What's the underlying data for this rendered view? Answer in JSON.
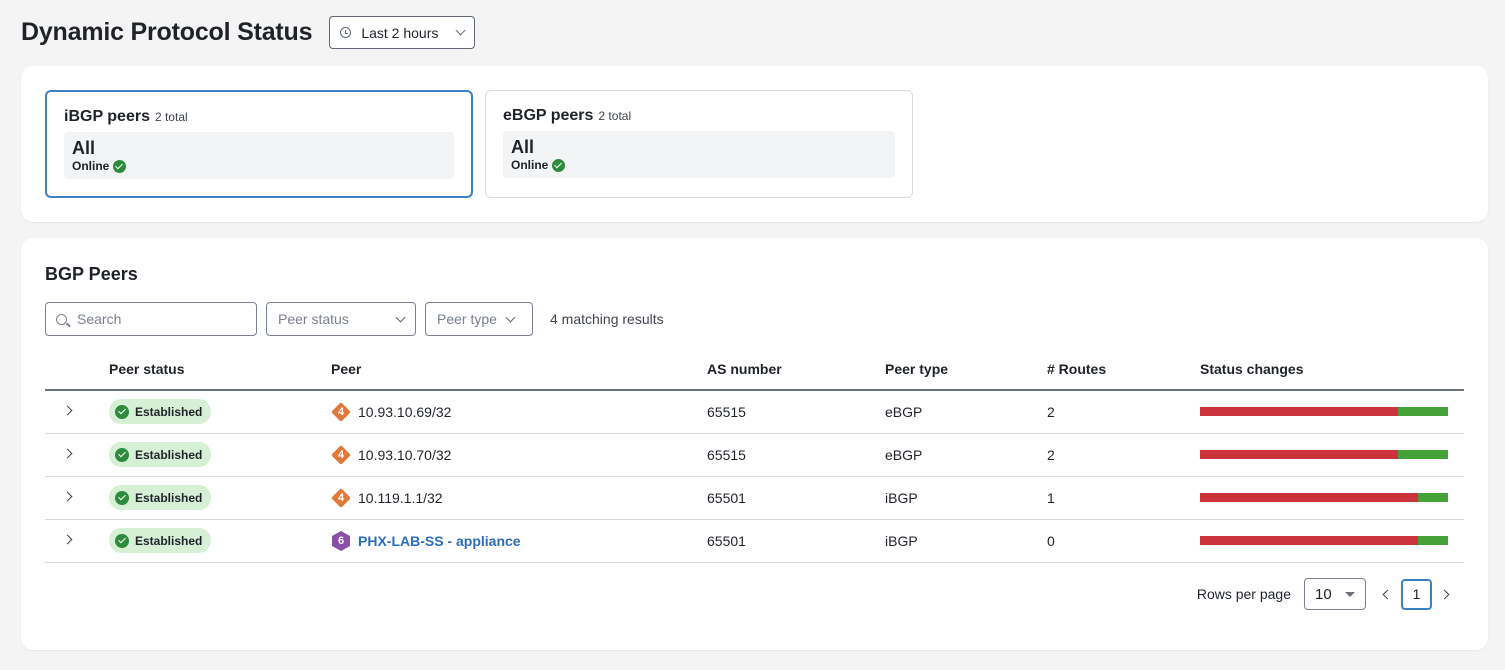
{
  "header": {
    "title": "Dynamic Protocol Status",
    "time_range": "Last 2 hours"
  },
  "summary": {
    "cards": [
      {
        "title": "iBGP peers",
        "count": "2 total",
        "value": "All",
        "status": "Online",
        "selected": true
      },
      {
        "title": "eBGP peers",
        "count": "2 total",
        "value": "All",
        "status": "Online",
        "selected": false
      }
    ]
  },
  "bgp": {
    "title": "BGP Peers",
    "search_placeholder": "Search",
    "filters": {
      "peer_status": "Peer status",
      "peer_type": "Peer type"
    },
    "match_count": "4 matching results",
    "columns": [
      "Peer status",
      "Peer",
      "AS number",
      "Peer type",
      "# Routes",
      "Status changes"
    ],
    "rows": [
      {
        "status": "Established",
        "ip_version": "4",
        "peer": "10.93.10.69/32",
        "is_link": false,
        "as_number": "65515",
        "peer_type": "eBGP",
        "routes": "2",
        "status_changes": {
          "established_fraction": 0.8,
          "color_a": "#cc343d",
          "color_b": "#45a238"
        }
      },
      {
        "status": "Established",
        "ip_version": "4",
        "peer": "10.93.10.70/32",
        "is_link": false,
        "as_number": "65515",
        "peer_type": "eBGP",
        "routes": "2",
        "status_changes": {
          "established_fraction": 0.8,
          "color_a": "#cc343d",
          "color_b": "#45a238"
        }
      },
      {
        "status": "Established",
        "ip_version": "4",
        "peer": "10.119.1.1/32",
        "is_link": false,
        "as_number": "65501",
        "peer_type": "iBGP",
        "routes": "1",
        "status_changes": {
          "established_fraction": 0.88,
          "color_a": "#cc343d",
          "color_b": "#45a238"
        }
      },
      {
        "status": "Established",
        "ip_version": "6",
        "peer": "PHX-LAB-SS - appliance",
        "is_link": true,
        "as_number": "65501",
        "peer_type": "iBGP",
        "routes": "0",
        "status_changes": {
          "established_fraction": 0.88,
          "color_a": "#cc343d",
          "color_b": "#45a238"
        }
      }
    ],
    "pagination": {
      "rows_per_page_label": "Rows per page",
      "rows_per_page": "10",
      "current_page": "1"
    }
  }
}
